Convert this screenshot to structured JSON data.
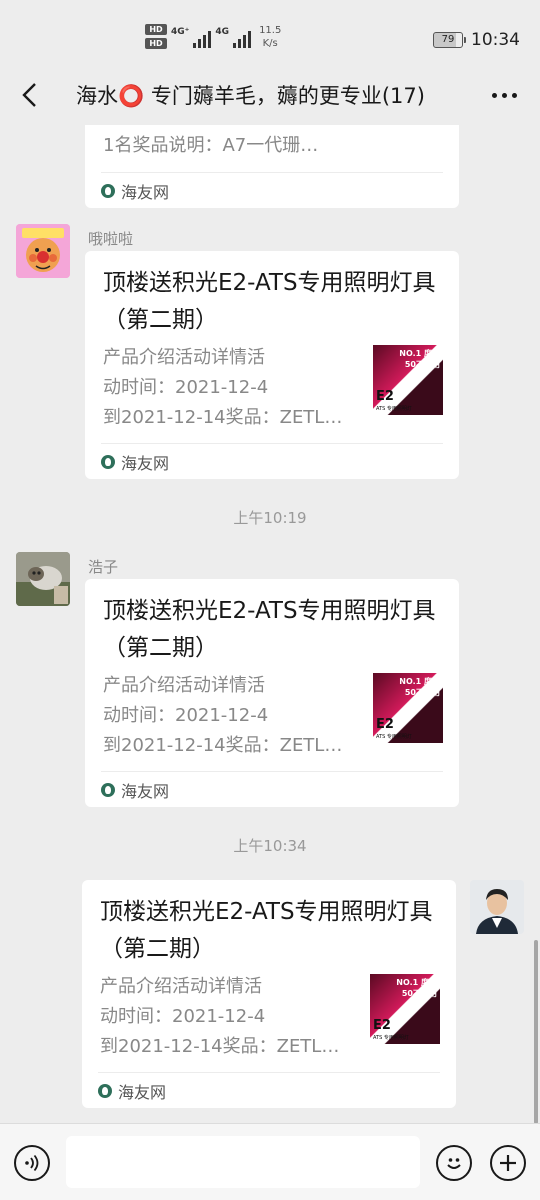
{
  "status_bar": {
    "hd_label": "HD",
    "net_1": "4G⁺",
    "net_2": "4G",
    "speed_value": "11.5",
    "speed_unit": "K/s",
    "battery": "79",
    "time": "10:34"
  },
  "header": {
    "title": "海水⭕ 专门薅羊毛，薅的更专业(17)",
    "back_icon": "chevron-left-icon",
    "more_icon": "more-dots-icon"
  },
  "messages": [
    {
      "type": "card",
      "side": "left",
      "partial": true,
      "desc_lines": [
        "1名奖品说明：A7一代珊…"
      ],
      "source": "海友网"
    },
    {
      "type": "card",
      "side": "left",
      "sender": "哦啦啦",
      "title": "顶楼送积光E2-ATS专用照明灯具（第二期）",
      "desc_lines": [
        "产品介绍活动详情活",
        "动时间：2021-12-4",
        "到2021-12-14奖品：ZETL…"
      ],
      "thumb": {
        "line1": "NO.1 度量",
        "line2": "50不要用",
        "big": "E2",
        "small": "ATS 专用照明灯"
      },
      "source": "海友网"
    },
    {
      "type": "time",
      "text": "上午10:19"
    },
    {
      "type": "card",
      "side": "left",
      "sender": "浩子",
      "title": "顶楼送积光E2-ATS专用照明灯具（第二期）",
      "desc_lines": [
        "产品介绍活动详情活",
        "动时间：2021-12-4",
        "到2021-12-14奖品：ZETL…"
      ],
      "thumb": {
        "line1": "NO.1 度量",
        "line2": "50不要用",
        "big": "E2",
        "small": "ATS 专用照明灯"
      },
      "source": "海友网"
    },
    {
      "type": "time",
      "text": "上午10:34"
    },
    {
      "type": "card",
      "side": "right",
      "title": "顶楼送积光E2-ATS专用照明灯具（第二期）",
      "desc_lines": [
        "产品介绍活动详情活",
        "动时间：2021-12-4",
        "到2021-12-14奖品：ZETL…"
      ],
      "thumb": {
        "line1": "NO.1 度量",
        "line2": "50不要用",
        "big": "E2",
        "small": "ATS 专用照明灯"
      },
      "source": "海友网"
    }
  ],
  "input_bar": {
    "voice_icon": "voice-icon",
    "emoji_icon": "emoji-icon",
    "plus_icon": "plus-icon",
    "input_value": ""
  },
  "colors": {
    "background": "#ededed",
    "card": "#ffffff",
    "muted_text": "#888888",
    "source_icon": "#2e6f5a",
    "thumb_accent": "#d21a5a"
  }
}
